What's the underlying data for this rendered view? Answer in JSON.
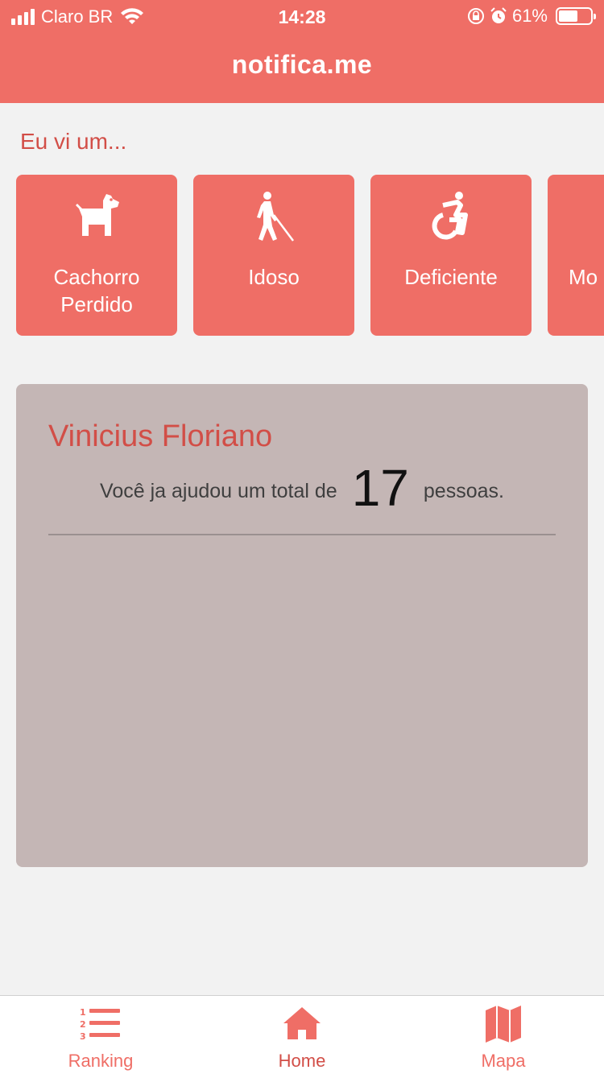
{
  "status_bar": {
    "carrier": "Claro BR",
    "time": "14:28",
    "battery": "61%",
    "battery_level": 0.61
  },
  "header": {
    "title": "notifica.me"
  },
  "section": {
    "title": "Eu vi um..."
  },
  "categories": [
    {
      "line1": "Cachorro",
      "line2": "Perdido",
      "icon": "dog-icon"
    },
    {
      "line1": "Idoso",
      "line2": "",
      "icon": "blind-elderly-icon"
    },
    {
      "line1": "Deficiente",
      "line2": "",
      "icon": "wheelchair-icon"
    },
    {
      "line1": "Mo",
      "line2": "",
      "icon": ""
    }
  ],
  "profile": {
    "name": "Vinicius Floriano",
    "help_prefix": "Você ja ajudou um total de",
    "help_count": "17",
    "help_suffix": "pessoas."
  },
  "tabs": [
    {
      "label": "Ranking",
      "icon": "ranking-list-icon",
      "active": false
    },
    {
      "label": "Home",
      "icon": "home-icon",
      "active": true
    },
    {
      "label": "Mapa",
      "icon": "map-icon",
      "active": false
    }
  ],
  "colors": {
    "accent": "#ef6e66",
    "accent_dark": "#d24e47",
    "panel": "#c4b6b5",
    "background": "#f2f2f2"
  }
}
